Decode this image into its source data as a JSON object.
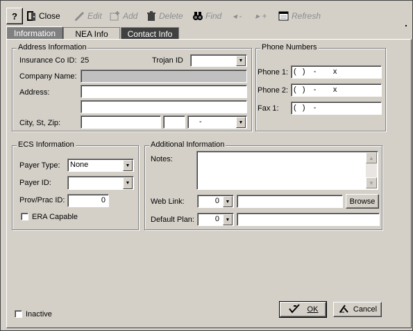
{
  "toolbar": {
    "help_label": "?",
    "close_label": "Close",
    "edit_label": "Edit",
    "add_label": "Add",
    "delete_label": "Delete",
    "find_label": "Find",
    "prev_label": "◂ -",
    "next_label": "▸ +",
    "refresh_label": "Refresh"
  },
  "tabs": [
    {
      "label": "Information"
    },
    {
      "label": "NEA Info"
    },
    {
      "label": "Contact Info"
    }
  ],
  "address": {
    "title": "Address Information",
    "insurance_label": "Insurance Co ID:",
    "insurance_value": "25",
    "trojan_label": "Trojan ID",
    "trojan_value": "",
    "company_label": "Company Name:",
    "company_value": "",
    "address_label": "Address:",
    "address1_value": "",
    "address2_value": "",
    "city_label": "City, St, Zip:",
    "city_value": "",
    "state_value": "",
    "zip_value": "-"
  },
  "phone": {
    "title": "Phone Numbers",
    "phone1_label": "Phone 1:",
    "phone1_value": "(   )    -        x",
    "phone2_label": "Phone 2:",
    "phone2_value": "(   )    -        x",
    "fax1_label": "Fax 1:",
    "fax1_value": "(   )    -"
  },
  "ecs": {
    "title": "ECS Information",
    "payer_type_label": "Payer Type:",
    "payer_type_value": "None",
    "payer_id_label": "Payer ID:",
    "payer_id_value": "",
    "provprac_label": "Prov/Prac ID:",
    "provprac_value": "0",
    "era_label": "ERA Capable"
  },
  "additional": {
    "title": "Additional Information",
    "notes_label": "Notes:",
    "notes_value": "",
    "weblink_label": "Web Link:",
    "weblink_num": "0",
    "weblink_value": "",
    "browse_label": "Browse",
    "default_plan_label": "Default Plan:",
    "default_plan_num": "0",
    "default_plan_value": ""
  },
  "footer": {
    "inactive_label": "Inactive",
    "ok_label": "OK",
    "cancel_label": "Cancel"
  },
  "icons": {
    "help": "question-icon",
    "close": "door-icon",
    "edit": "pencil-icon",
    "add": "add-icon",
    "delete": "trash-icon",
    "find": "binoculars-icon",
    "refresh": "refresh-icon",
    "ok": "checkmark-icon",
    "cancel": "cancel-icon"
  }
}
